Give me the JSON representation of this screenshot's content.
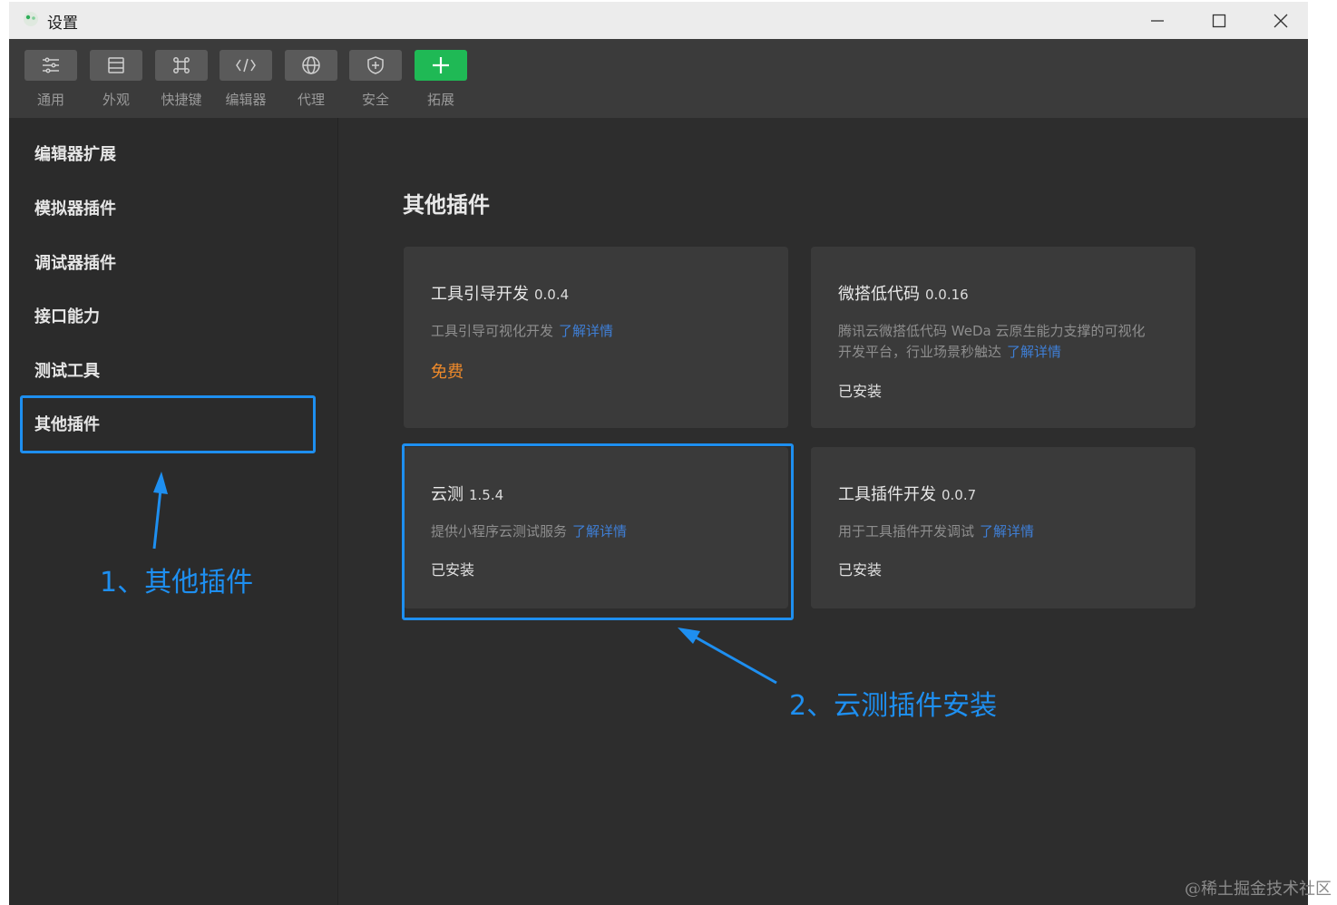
{
  "window": {
    "title": "设置"
  },
  "toolbar": {
    "items": [
      {
        "label": "通用",
        "icon": "sliders-icon"
      },
      {
        "label": "外观",
        "icon": "layout-icon"
      },
      {
        "label": "快捷键",
        "icon": "command-icon"
      },
      {
        "label": "编辑器",
        "icon": "code-icon"
      },
      {
        "label": "代理",
        "icon": "globe-icon"
      },
      {
        "label": "安全",
        "icon": "shield-icon"
      },
      {
        "label": "拓展",
        "icon": "plus-icon",
        "active": true
      }
    ]
  },
  "sidebar": {
    "items": [
      {
        "label": "编辑器扩展"
      },
      {
        "label": "模拟器插件"
      },
      {
        "label": "调试器插件"
      },
      {
        "label": "接口能力"
      },
      {
        "label": "测试工具"
      },
      {
        "label": "其他插件",
        "selected": true
      }
    ]
  },
  "main": {
    "section_title": "其他插件",
    "plugins": [
      {
        "name": "工具引导开发",
        "version": "0.0.4",
        "description": "工具引导可视化开发",
        "link": "了解详情",
        "status": "免费"
      },
      {
        "name": "微搭低代码",
        "version": "0.0.16",
        "description_line1": "腾讯云微搭低代码 WeDa 云原生能力支撑的可视化",
        "description_line2": "开发平台，行业场景秒触达",
        "link": "了解详情",
        "status": "已安装"
      },
      {
        "name": "云测",
        "version": "1.5.4",
        "description": "提供小程序云测试服务",
        "link": "了解详情",
        "status": "已安装"
      },
      {
        "name": "工具插件开发",
        "version": "0.0.7",
        "description": "用于工具插件开发调试",
        "link": "了解详情",
        "status": "已安装"
      }
    ]
  },
  "annotations": [
    {
      "text": "1、其他插件"
    },
    {
      "text": "2、云测插件安装"
    }
  ],
  "watermark": "@稀土掘金技术社区",
  "colors": {
    "accent": "#1e8ff0",
    "free": "#ef8a2a",
    "link": "#3f7fd6",
    "install_button": "#1fb955"
  }
}
